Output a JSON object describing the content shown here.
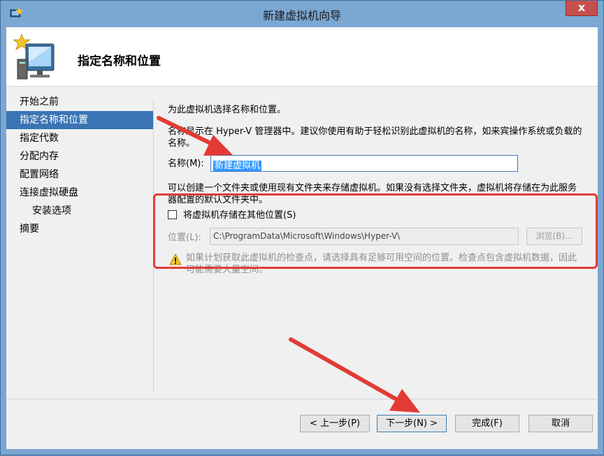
{
  "window": {
    "title": "新建虚拟机向导",
    "close_label": "x",
    "app_icon": "hyper-v-icon"
  },
  "header": {
    "title": "指定名称和位置",
    "icon": "new-vm-wizard-icon"
  },
  "nav": {
    "items": [
      {
        "label": "开始之前"
      },
      {
        "label": "指定名称和位置",
        "selected": true
      },
      {
        "label": "指定代数"
      },
      {
        "label": "分配内存"
      },
      {
        "label": "配置网络"
      },
      {
        "label": "连接虚拟硬盘"
      },
      {
        "label": "安装选项",
        "indent": true
      },
      {
        "label": "摘要"
      }
    ]
  },
  "content": {
    "intro": "为此虚拟机选择名称和位置。",
    "description": "名称显示在 Hyper-V 管理器中。建议你使用有助于轻松识别此虚拟机的名称，如来宾操作系统或负载的名称。",
    "name_label": "名称(M):",
    "name_value": "新建虚拟机",
    "folder_description": "可以创建一个文件夹或使用现有文件夹来存储虚拟机。如果没有选择文件夹，虚拟机将存储在为此服务器配置的默认文件夹中。",
    "store_checkbox": {
      "label": "将虚拟机存储在其他位置(S)",
      "checked": false
    },
    "location_label": "位置(L):",
    "location_value": "C:\\ProgramData\\Microsoft\\Windows\\Hyper-V\\",
    "browse_label": "浏览(B)...",
    "warning_icon": "warning-icon",
    "warning_text": "如果计划获取此虚拟机的检查点，请选择具有足够可用空间的位置。检查点包含虚拟机数据，因此可能需要大量空间。"
  },
  "buttons": {
    "prev": "< 上一步(P)",
    "next": "下一步(N) >",
    "finish": "完成(F)",
    "cancel": "取消"
  },
  "colors": {
    "accent": "#3a74b5",
    "annotation": "#e23b36"
  }
}
